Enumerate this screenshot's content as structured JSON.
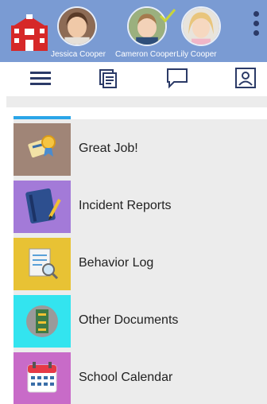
{
  "children": [
    {
      "name": "Jessica Cooper"
    },
    {
      "name": "Cameron Cooper"
    },
    {
      "name": "Lily Cooper"
    }
  ],
  "toolbar": {
    "icons": [
      "hamburger-menu-icon",
      "documents-stack-icon",
      "chat-bubble-icon",
      "profile-card-icon"
    ]
  },
  "menu": [
    {
      "label": "Great Job!",
      "icon": "award-icon",
      "color": "#a08577"
    },
    {
      "label": "Incident Reports",
      "icon": "notebook-pen-icon",
      "color": "#a37ad8"
    },
    {
      "label": "Behavior Log",
      "icon": "log-magnifier-icon",
      "color": "#e8c234"
    },
    {
      "label": "Other Documents",
      "icon": "file-cabinet-icon",
      "color": "#33e4ef"
    },
    {
      "label": "School Calendar",
      "icon": "calendar-icon",
      "color": "#c86bc8"
    }
  ],
  "colors": {
    "header": "#7a9bd3",
    "accent": "#2aa5e8",
    "icon_navy": "#2b3a67",
    "row_bg": "#ececec"
  }
}
